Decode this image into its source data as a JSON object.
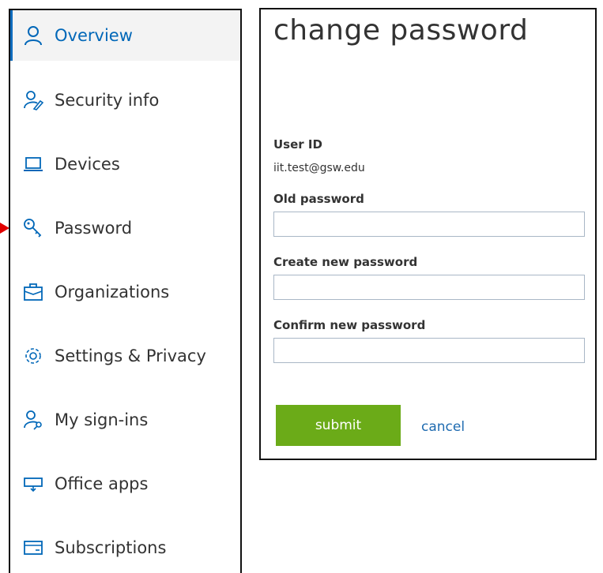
{
  "sidebar": {
    "items": [
      {
        "label": "Overview",
        "icon": "person-icon"
      },
      {
        "label": "Security info",
        "icon": "security-info-icon"
      },
      {
        "label": "Devices",
        "icon": "laptop-icon"
      },
      {
        "label": "Password",
        "icon": "key-icon"
      },
      {
        "label": "Organizations",
        "icon": "briefcase-icon"
      },
      {
        "label": "Settings & Privacy",
        "icon": "gear-icon"
      },
      {
        "label": "My sign-ins",
        "icon": "signins-icon"
      },
      {
        "label": "Office apps",
        "icon": "office-apps-icon"
      },
      {
        "label": "Subscriptions",
        "icon": "subscriptions-icon"
      }
    ],
    "active_item": "Overview"
  },
  "dialog": {
    "title": "change password",
    "user_id_label": "User ID",
    "user_id_value": "iit.test@gsw.edu",
    "old_password_label": "Old password",
    "new_password_label": "Create new password",
    "confirm_password_label": "Confirm new password",
    "old_password_value": "",
    "new_password_value": "",
    "confirm_password_value": "",
    "submit_label": "submit",
    "cancel_label": "cancel"
  },
  "colors": {
    "accent": "#0067b8",
    "submit_bg": "#6bab18",
    "link": "#1f6bb0",
    "pointer_arrow": "#e00000"
  }
}
